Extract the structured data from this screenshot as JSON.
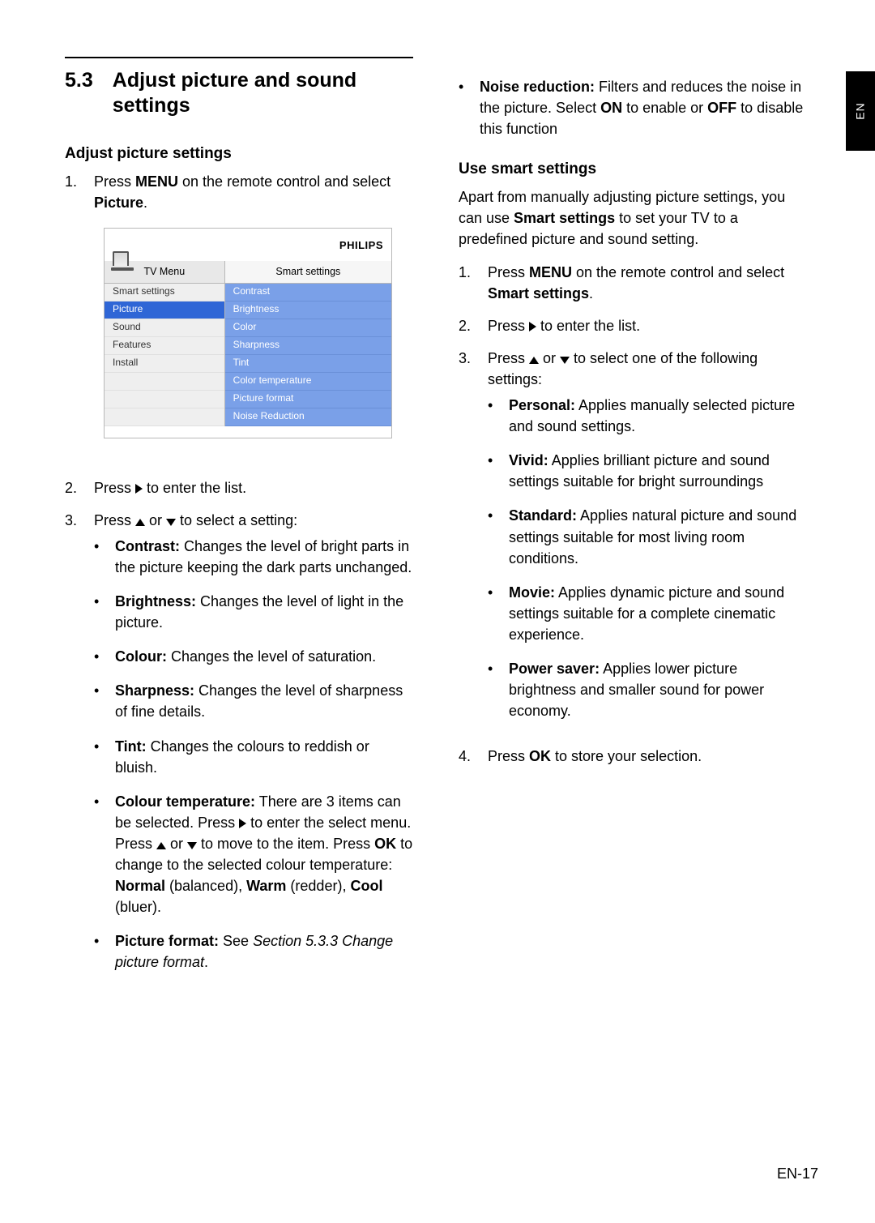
{
  "sideTab": "EN",
  "section": {
    "number": "5.3",
    "title": "Adjust picture and sound settings"
  },
  "left": {
    "heading": "Adjust picture settings",
    "step1": {
      "prefix": "Press ",
      "key": "MENU",
      "mid": " on the remote control and select ",
      "target": "Picture",
      "suffix": "."
    },
    "tvMenu": {
      "brand": "PHILIPS",
      "leftTab": "TV Menu",
      "rightTab": "Smart settings",
      "leftItems": [
        "Smart settings",
        "Picture",
        "Sound",
        "Features",
        "Install"
      ],
      "leftSelected": "Picture",
      "rightItems": [
        "Contrast",
        "Brightness",
        "Color",
        "Sharpness",
        "Tint",
        "Color temperature",
        "Picture format",
        "Noise Reduction"
      ]
    },
    "step2": {
      "prefix": "Press ",
      "suffix": " to enter the list."
    },
    "step3": {
      "prefix": "Press ",
      "mid": " or ",
      "suffix": " to select a setting:"
    },
    "settings": {
      "contrast": {
        "label": "Contrast:",
        "text": " Changes the level of bright parts in the picture keeping the dark parts unchanged."
      },
      "brightness": {
        "label": "Brightness:",
        "text": " Changes the level of light in the picture."
      },
      "colour": {
        "label": "Colour:",
        "text": " Changes the level of saturation."
      },
      "sharpness": {
        "label": "Sharpness:",
        "text": " Changes the level of sharpness of fine details."
      },
      "tint": {
        "label": "Tint:",
        "text": " Changes the colours to reddish or bluish."
      },
      "colourTemp": {
        "label": "Colour temperature:",
        "part1": " There are 3 items can be selected. Press ",
        "part2": " to enter the select menu. Press ",
        "part3": " or ",
        "part4": " to move to the item. Press ",
        "okKey": "OK",
        "part5": " to change to the selected colour temperature: ",
        "normal": "Normal",
        "normalDesc": " (balanced), ",
        "warm": "Warm",
        "warmDesc": " (redder), ",
        "cool": "Cool",
        "coolDesc": " (bluer)."
      },
      "pictureFormat": {
        "label": "Picture format:",
        "see": " See ",
        "ref": "Section 5.3.3 Change picture format",
        "dot": "."
      }
    }
  },
  "right": {
    "noise": {
      "label": "Noise reduction:",
      "part1": " Filters and reduces the noise in the picture. Select ",
      "on": "ON",
      "part2": " to enable or ",
      "off": "OFF",
      "part3": " to disable this function"
    },
    "heading": "Use smart settings",
    "intro": {
      "part1": "Apart from manually adjusting picture settings, you can use ",
      "bold": "Smart settings",
      "part2": " to set your TV to a predefined picture and sound setting."
    },
    "step1": {
      "prefix": "Press ",
      "key": "MENU",
      "mid": " on the remote control and select ",
      "target": "Smart settings",
      "suffix": "."
    },
    "step2": {
      "prefix": "Press ",
      "suffix": " to enter the list."
    },
    "step3": {
      "prefix": "Press ",
      "mid": " or ",
      "suffix": " to select one of the following settings:"
    },
    "options": {
      "personal": {
        "label": "Personal:",
        "text": " Applies manually selected picture and sound settings."
      },
      "vivid": {
        "label": "Vivid:",
        "text": " Applies brilliant picture and sound settings suitable for bright surroundings"
      },
      "standard": {
        "label": "Standard:",
        "text": " Applies natural picture and sound settings suitable for most living room conditions."
      },
      "movie": {
        "label": "Movie:",
        "text": " Applies dynamic picture and sound settings suitable for a complete cinematic experience."
      },
      "powerSaver": {
        "label": "Power saver:",
        "text": " Applies lower picture brightness and smaller sound for power economy."
      }
    },
    "step4": {
      "prefix": "Press ",
      "key": "OK",
      "suffix": " to store your selection."
    }
  },
  "footer": "EN-17"
}
